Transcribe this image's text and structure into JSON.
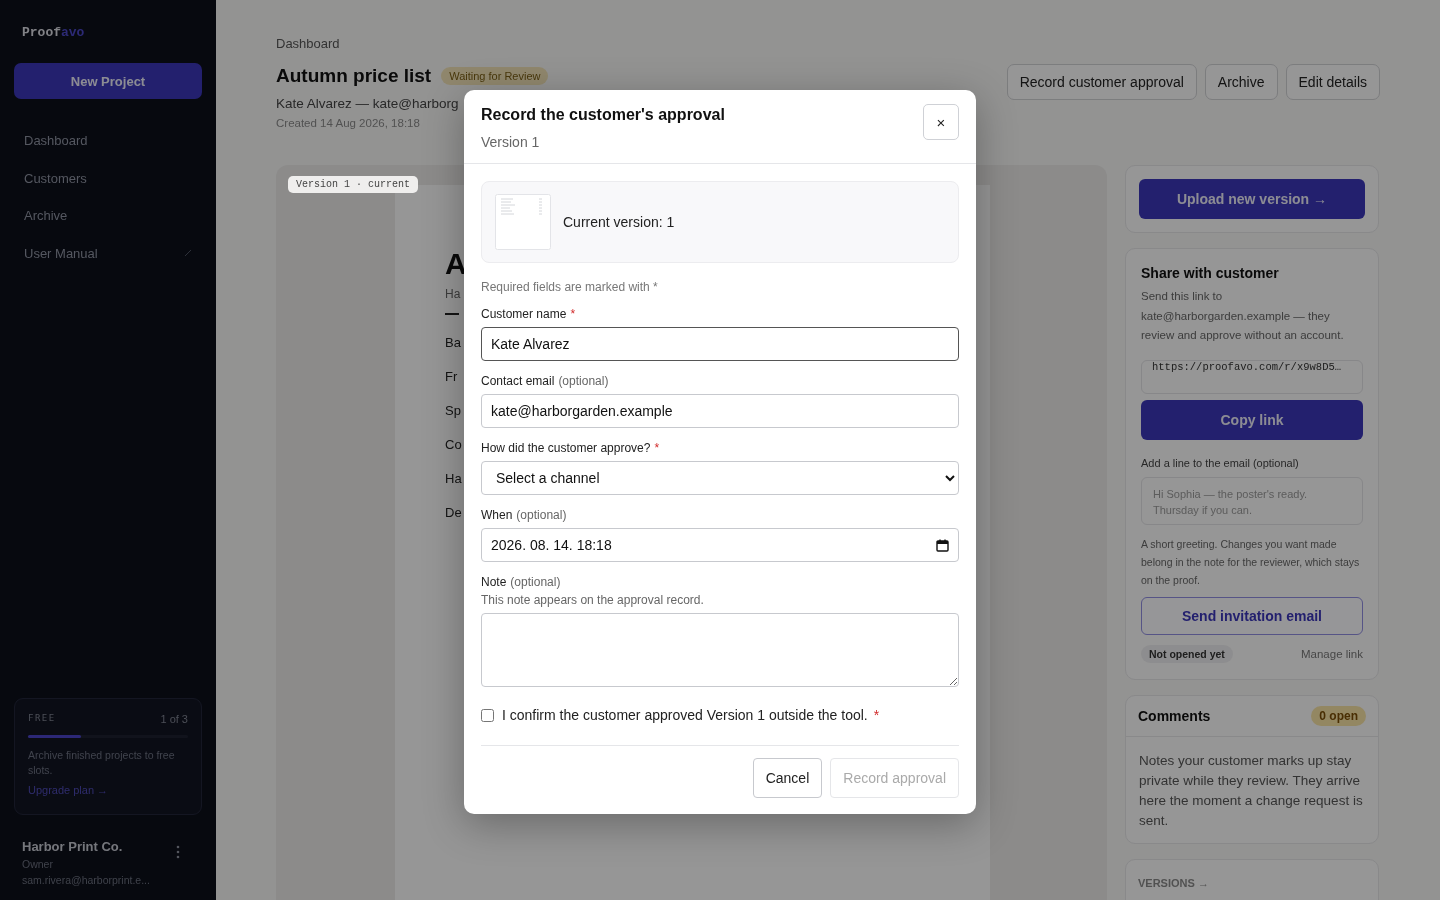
{
  "sidebar": {
    "logo_main": "Proof",
    "logo_accent": "avo",
    "new_button": "New Project",
    "items": [
      {
        "label": "Dashboard",
        "external": false
      },
      {
        "label": "Customers",
        "external": false
      },
      {
        "label": "Archive",
        "external": false
      },
      {
        "label": "User Manual",
        "external": true
      }
    ],
    "plan": {
      "name": "FREE",
      "count": "1 of 3",
      "level": 0.33,
      "note": "Archive finished projects to free slots.",
      "link": "Upgrade plan →"
    },
    "account": {
      "name": "Harbor Print Co.",
      "role": "Owner",
      "email": "sam.rivera@harborprint.e..."
    }
  },
  "header": {
    "breadcrumb": "Dashboard",
    "title": "Autumn price list",
    "status": "Waiting for Review",
    "customer": "Kate Alvarez — kate@harborg",
    "created": "Created 14 Aug 2026, 18:18",
    "actions": [
      "Record customer approval",
      "Archive",
      "Edit details"
    ]
  },
  "proof": {
    "version_tag": "Version 1 · current",
    "heading": "A",
    "subheading": "Ha",
    "lines": [
      "Ba",
      "Fr",
      "Sp",
      "Co",
      "Ha",
      "De"
    ]
  },
  "side": {
    "upload": "Upload new version →",
    "share": {
      "title": "Share with customer",
      "text": "Send this link to kate@harborgarden.example — they review and approve without an account.",
      "link": "https://proofavo.com/r/x9w8D5…",
      "copy": "Copy link",
      "line_label": "Add a line to the email (optional)",
      "line_placeholder": "Hi Sophia — the poster's ready. Thursday if you can.",
      "help": "A short greeting. Changes you want made belong in the note for the reviewer, which stays on the proof.",
      "send": "Send invitation email",
      "status": "Not opened yet",
      "manage": "Manage link"
    },
    "comments": {
      "title": "Comments",
      "badge": "0 open",
      "text": "Notes your customer marks up stay private while they review. They arrive here the moment a change request is sent."
    },
    "versions": "VERSIONS →"
  },
  "modal": {
    "title": "Record the customer's approval",
    "subtitle": "Version 1",
    "close": "×",
    "current": "Current version: 1",
    "required_note": "Required fields are marked with *",
    "fields": [
      {
        "kind": "text",
        "label": "Customer name",
        "mark": "*",
        "value": "Kate Alvarez"
      },
      {
        "kind": "text",
        "label": "Contact email",
        "optional": "(optional)",
        "value": "kate@harborgarden.example"
      },
      {
        "kind": "select",
        "label": "How did the customer approve?",
        "mark": "*",
        "value": "Select a channel"
      },
      {
        "kind": "date",
        "label": "When",
        "optional": "(optional)",
        "value": "2026. 08. 14. 18:18"
      },
      {
        "kind": "textarea",
        "label": "Note",
        "optional": "(optional)",
        "help": "This note appears on the approval record."
      }
    ],
    "confirm": {
      "text": "I confirm the customer approved Version 1 outside the tool.",
      "mark": "*",
      "checked": false
    },
    "cancel": "Cancel",
    "submit": {
      "label": "Record approval",
      "disabled": true
    }
  }
}
